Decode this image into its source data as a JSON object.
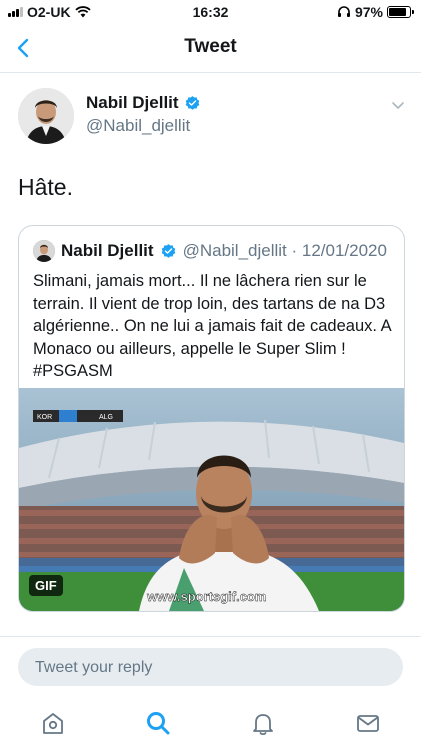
{
  "status_bar": {
    "carrier": "O2-UK",
    "time": "16:32",
    "battery": "97%",
    "battery_level": 0.97
  },
  "nav": {
    "title": "Tweet",
    "back_icon": "chevron-left-icon"
  },
  "tweet": {
    "author_name": "Nabil Djellit",
    "author_handle": "@Nabil_djellit",
    "text": "Hâte."
  },
  "quote": {
    "author_name": "Nabil Djellit",
    "handle_date": "@Nabil_djellit · 12/01/2020",
    "text": "Slimani, jamais mort... Il ne lâchera rien sur le terrain. Il vient de trop loin, des tartans de na D3 algérienne.. On ne lui a jamais fait de cadeaux. A Monaco ou ailleurs, appelle le Super Slim ! #PSGASM",
    "media_badge": "GIF",
    "media_watermark": "www.sportsgif.com",
    "scoreboard_left": "KOR",
    "scoreboard_right": "ALG"
  },
  "reply": {
    "placeholder": "Tweet your reply"
  },
  "tabs": [
    {
      "name": "home",
      "icon": "home-icon"
    },
    {
      "name": "search",
      "icon": "search-icon",
      "active": true
    },
    {
      "name": "notifications",
      "icon": "bell-icon"
    },
    {
      "name": "messages",
      "icon": "mail-icon"
    }
  ],
  "colors": {
    "accent": "#1da1f2",
    "text": "#14171a",
    "secondary": "#657786",
    "border": "#ccd6dd"
  }
}
